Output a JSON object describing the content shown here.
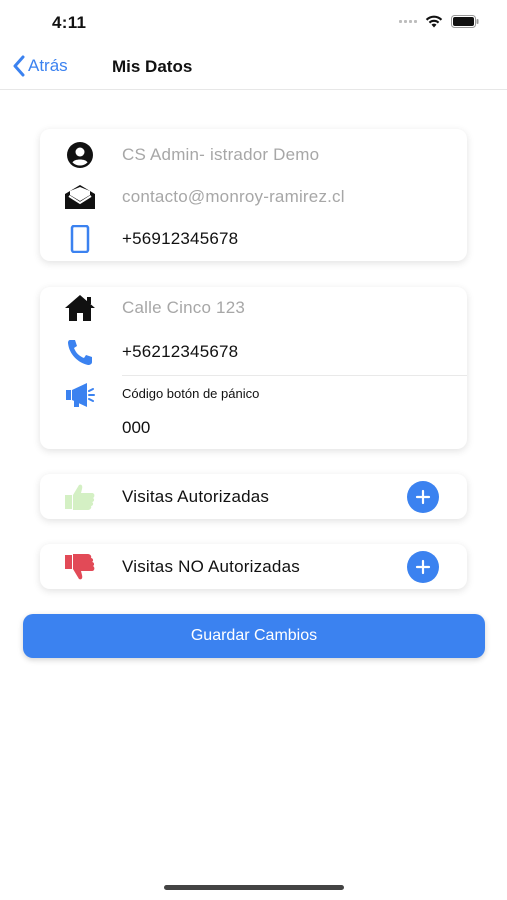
{
  "status_bar": {
    "time": "4:11"
  },
  "nav": {
    "back_label": "Atrás",
    "title": "Mis Datos"
  },
  "profile_card": {
    "name": "CS Admin- istrador Demo",
    "email": "contacto@monroy-ramirez.cl",
    "mobile": "+56912345678"
  },
  "address_card": {
    "address": "Calle Cinco 123",
    "phone": "+56212345678",
    "panic_label": "Código botón de pánico",
    "panic_code": "000"
  },
  "authorized": {
    "label": "Visitas Autorizadas"
  },
  "unauthorized": {
    "label": "Visitas NO Autorizadas"
  },
  "save_button": {
    "label": "Guardar Cambios"
  },
  "colors": {
    "accent": "#3b82f0",
    "thumbs_up": "#d4f0c4",
    "thumbs_down": "#e24a57"
  }
}
